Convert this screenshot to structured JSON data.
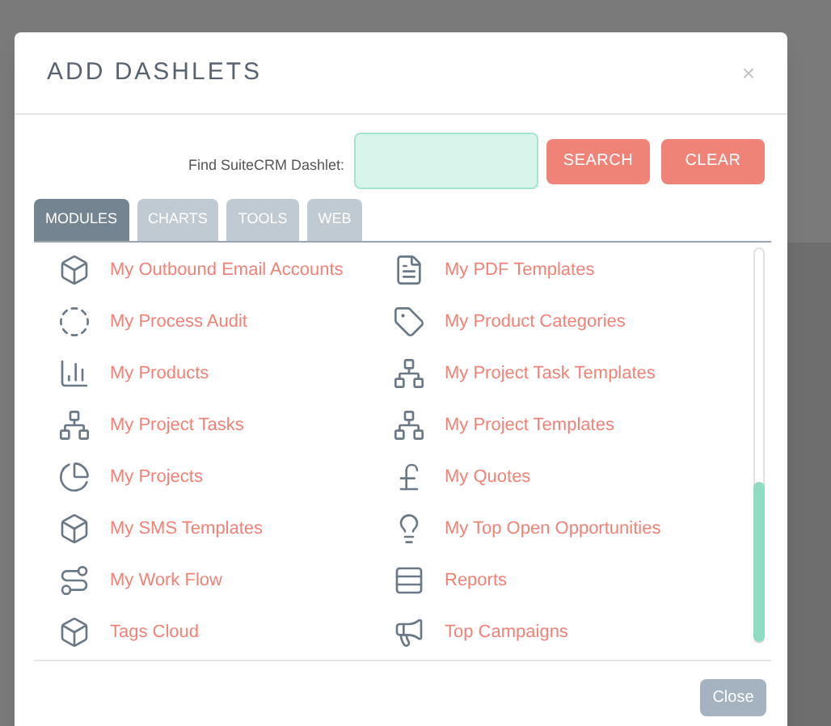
{
  "dialog": {
    "title": "ADD DASHLETS",
    "close": "×"
  },
  "search": {
    "label": "Find SuiteCRM Dashlet:",
    "buttons": [
      "SEARCH",
      "CLEAR"
    ]
  },
  "tabs": [
    {
      "label": "MODULES",
      "selected": true
    },
    {
      "label": "CHARTS",
      "selected": false
    },
    {
      "label": "TOOLS",
      "selected": false
    },
    {
      "label": "WEB",
      "selected": false
    }
  ],
  "dashlets": [
    {
      "left": "My Outbound Email Accounts",
      "right": "My PDF Templates"
    },
    {
      "left": "My Process Audit",
      "right": "My Product Categories"
    },
    {
      "left": "My Products",
      "right": "My Project Task Templates"
    },
    {
      "left": "My Project Tasks",
      "right": "My Project Templates"
    },
    {
      "left": "My Projects",
      "right": "My Quotes"
    },
    {
      "left": "My SMS Templates",
      "right": "My Top Open Opportunities"
    },
    {
      "left": "My Work Flow",
      "right": "Reports"
    },
    {
      "left": "Tags Cloud",
      "right": "Top Campaigns"
    }
  ],
  "footer": {
    "button": "Close"
  }
}
